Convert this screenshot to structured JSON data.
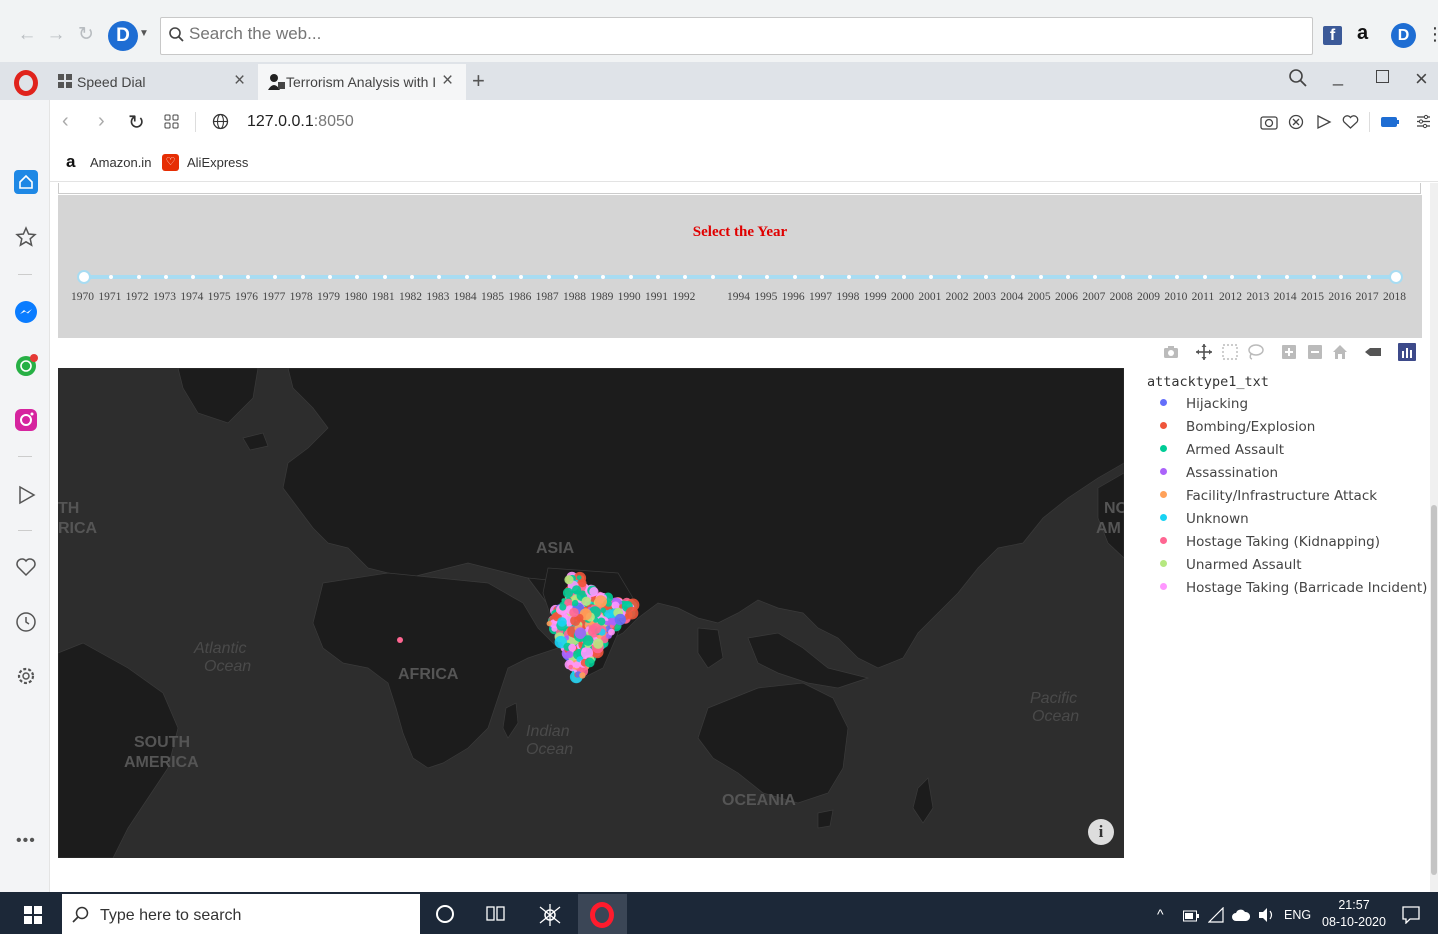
{
  "browser": {
    "search_placeholder": "Search the web...",
    "tabs": [
      {
        "label": "Speed Dial"
      },
      {
        "label": "Terrorism Analysis with Insi"
      }
    ],
    "url_host": "127.0.0.1",
    "url_port": ":8050",
    "bookmarks": [
      {
        "label": "Amazon.in"
      },
      {
        "label": "AliExpress"
      }
    ]
  },
  "year_slider": {
    "title": "Select the Year",
    "years_left": [
      "1970",
      "1971",
      "1972",
      "1973",
      "1974",
      "1975",
      "1976",
      "1977",
      "1978",
      "1979",
      "1980",
      "1981",
      "1982",
      "1983",
      "1984",
      "1985",
      "1986",
      "1987",
      "1988",
      "1989",
      "1990",
      "1991",
      "1992"
    ],
    "years_right": [
      "1994",
      "1995",
      "1996",
      "1997",
      "1998",
      "1999",
      "2000",
      "2001",
      "2002",
      "2003",
      "2004",
      "2005",
      "2006",
      "2007",
      "2008",
      "2009",
      "2010",
      "2011",
      "2012",
      "2013",
      "2014",
      "2015",
      "2016",
      "2017",
      "2018"
    ],
    "selected_range": [
      "1970",
      "2018"
    ],
    "track_color": "#a8dcf2"
  },
  "map": {
    "labels": [
      "ASIA",
      "AFRICA",
      "SOUTH AMERICA",
      "OCEANIA",
      "Atlantic Ocean",
      "Indian Ocean",
      "Pacific Ocean",
      "TH RICA",
      "NO AM"
    ],
    "label_texts": {
      "asia": "ASIA",
      "africa": "AFRICA",
      "south_america_1": "SOUTH",
      "south_america_2": "AMERICA",
      "oceania": "OCEANIA",
      "atlantic_1": "Atlantic",
      "atlantic_2": "Ocean",
      "indian_1": "Indian",
      "indian_2": "Ocean",
      "pacific_1": "Pacific",
      "pacific_2": "Ocean",
      "edge_left_1": "TH",
      "edge_left_2": "RICA",
      "edge_right_1": "NO",
      "edge_right_2": "AM"
    },
    "background": "#2d2d2d",
    "land_color": "#1c1c1c"
  },
  "legend": {
    "title": "attacktype1_txt",
    "items": [
      {
        "label": "Hijacking",
        "color": "#636efa"
      },
      {
        "label": "Bombing/Explosion",
        "color": "#ef553b"
      },
      {
        "label": "Armed Assault",
        "color": "#00cc96"
      },
      {
        "label": "Assassination",
        "color": "#ab63fa"
      },
      {
        "label": "Facility/Infrastructure Attack",
        "color": "#ffa15a"
      },
      {
        "label": "Unknown",
        "color": "#19d3f3"
      },
      {
        "label": "Hostage Taking (Kidnapping)",
        "color": "#ff6692"
      },
      {
        "label": "Unarmed Assault",
        "color": "#b6e880"
      },
      {
        "label": "Hostage Taking (Barricade Incident)",
        "color": "#ff97ff"
      }
    ]
  },
  "taskbar": {
    "search_placeholder": "Type here to search",
    "language": "ENG",
    "time": "21:57",
    "date": "08-10-2020"
  }
}
